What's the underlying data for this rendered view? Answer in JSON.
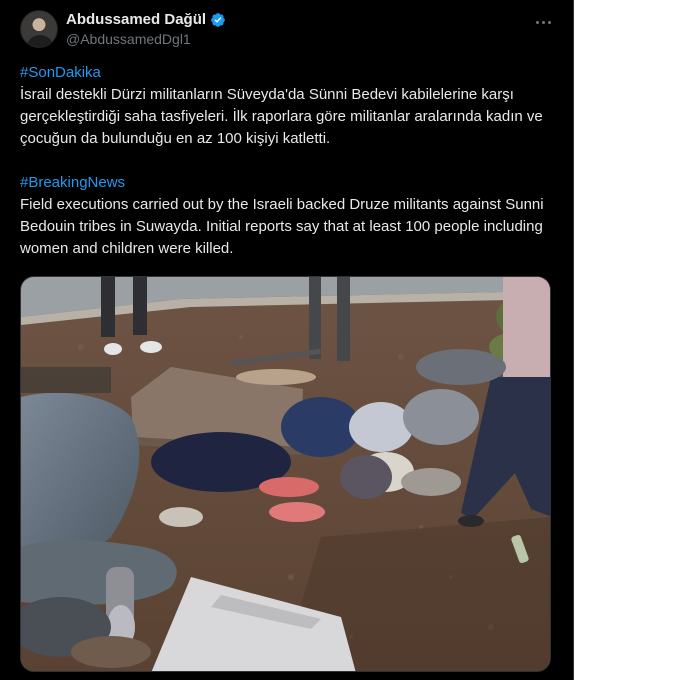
{
  "author": {
    "display_name": "Abdussamed Dağül",
    "handle": "@AbdussamedDgl1",
    "verified": true
  },
  "tweet": {
    "hashtag_tr": "#SonDakika",
    "text_tr": "İsrail destekli Dürzi militanların Süveyda'da Sünni Bedevi kabilelerine karşı gerçekleştirdiği saha tasfiyeleri. İlk raporlara göre militanlar aralarında kadın ve çocuğun da bulunduğu en az 100 kişiyi katletti.",
    "hashtag_en": "#BreakingNews",
    "text_en": "Field executions carried out by the Israeli backed Druze militants against Sunni Bedouin tribes in Suwayda. Initial reports say that at least 100 people including women and children were killed."
  },
  "icons": {
    "verified": "verified-badge-icon",
    "more": "more-options-icon"
  },
  "colors": {
    "background": "#000000",
    "text": "#e7e9ea",
    "secondary_text": "#71767b",
    "link": "#1d9bf0",
    "verified_badge": "#1d9bf0"
  }
}
